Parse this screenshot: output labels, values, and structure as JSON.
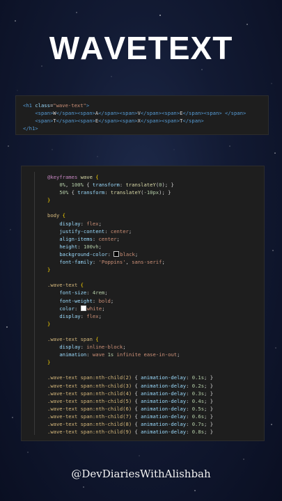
{
  "title": {
    "letters": [
      "W",
      "A",
      "V",
      "E",
      "T",
      "E",
      "X",
      "T"
    ]
  },
  "html_code": [
    [
      [
        "tag",
        "<h1 "
      ],
      [
        "attr",
        "class"
      ],
      [
        "txt",
        "="
      ],
      [
        "str",
        "\"wave-text\""
      ],
      [
        "tag",
        ">"
      ]
    ],
    [
      [
        "txt",
        "    "
      ],
      [
        "tag",
        "<span>"
      ],
      [
        "txt",
        "W"
      ],
      [
        "tag",
        "</span><span>"
      ],
      [
        "txt",
        "A"
      ],
      [
        "tag",
        "</span><span>"
      ],
      [
        "txt",
        "V"
      ],
      [
        "tag",
        "</span><span>"
      ],
      [
        "txt",
        "E"
      ],
      [
        "tag",
        "</span><span>"
      ],
      [
        "txt",
        " "
      ],
      [
        "tag",
        "</span>"
      ]
    ],
    [
      [
        "txt",
        "    "
      ],
      [
        "tag",
        "<span>"
      ],
      [
        "txt",
        "T"
      ],
      [
        "tag",
        "</span><span>"
      ],
      [
        "txt",
        "E"
      ],
      [
        "tag",
        "</span><span>"
      ],
      [
        "txt",
        "X"
      ],
      [
        "tag",
        "</span><span>"
      ],
      [
        "txt",
        "T"
      ],
      [
        "tag",
        "</span>"
      ]
    ],
    [
      [
        "tag",
        "</h1>"
      ]
    ]
  ],
  "css_code": [
    [
      [
        "kw",
        "@keyframes"
      ],
      [
        "txt",
        " "
      ],
      [
        "name",
        "wave"
      ],
      [
        "txt",
        " "
      ],
      [
        "brace",
        "{"
      ]
    ],
    [
      [
        "txt",
        "    "
      ],
      [
        "num",
        "0%"
      ],
      [
        "txt",
        ", "
      ],
      [
        "num",
        "100%"
      ],
      [
        "txt",
        " { "
      ],
      [
        "prop",
        "transform"
      ],
      [
        "txt",
        ": "
      ],
      [
        "fn",
        "translateY"
      ],
      [
        "txt",
        "("
      ],
      [
        "num",
        "0"
      ],
      [
        "txt",
        "); }"
      ]
    ],
    [
      [
        "txt",
        "    "
      ],
      [
        "num",
        "50%"
      ],
      [
        "txt",
        " { "
      ],
      [
        "prop",
        "transform"
      ],
      [
        "txt",
        ": "
      ],
      [
        "fn",
        "translateY"
      ],
      [
        "txt",
        "("
      ],
      [
        "num",
        "-10px"
      ],
      [
        "txt",
        "); }"
      ]
    ],
    [
      [
        "brace",
        "}"
      ]
    ],
    [],
    [
      [
        "sel",
        "body"
      ],
      [
        "txt",
        " "
      ],
      [
        "brace",
        "{"
      ]
    ],
    [
      [
        "txt",
        "    "
      ],
      [
        "prop",
        "display"
      ],
      [
        "txt",
        ": "
      ],
      [
        "val",
        "flex"
      ],
      [
        "txt",
        ";"
      ]
    ],
    [
      [
        "txt",
        "    "
      ],
      [
        "prop",
        "justify-content"
      ],
      [
        "txt",
        ": "
      ],
      [
        "val",
        "center"
      ],
      [
        "txt",
        ";"
      ]
    ],
    [
      [
        "txt",
        "    "
      ],
      [
        "prop",
        "align-items"
      ],
      [
        "txt",
        ": "
      ],
      [
        "val",
        "center"
      ],
      [
        "txt",
        ";"
      ]
    ],
    [
      [
        "txt",
        "    "
      ],
      [
        "prop",
        "height"
      ],
      [
        "txt",
        ": "
      ],
      [
        "num",
        "100vh"
      ],
      [
        "txt",
        ";"
      ]
    ],
    [
      [
        "txt",
        "    "
      ],
      [
        "prop",
        "background-color"
      ],
      [
        "txt",
        ": "
      ],
      [
        "swatch",
        "#000000"
      ],
      [
        "val",
        "black"
      ],
      [
        "txt",
        ";"
      ]
    ],
    [
      [
        "txt",
        "    "
      ],
      [
        "prop",
        "font-family"
      ],
      [
        "txt",
        ": "
      ],
      [
        "str",
        "'Poppins'"
      ],
      [
        "txt",
        ", "
      ],
      [
        "val",
        "sans-serif"
      ],
      [
        "txt",
        ";"
      ]
    ],
    [
      [
        "brace",
        "}"
      ]
    ],
    [],
    [
      [
        "sel",
        ".wave-text"
      ],
      [
        "txt",
        " "
      ],
      [
        "brace",
        "{"
      ]
    ],
    [
      [
        "txt",
        "    "
      ],
      [
        "prop",
        "font-size"
      ],
      [
        "txt",
        ": "
      ],
      [
        "num",
        "4rem"
      ],
      [
        "txt",
        ";"
      ]
    ],
    [
      [
        "txt",
        "    "
      ],
      [
        "prop",
        "font-weight"
      ],
      [
        "txt",
        ": "
      ],
      [
        "val",
        "bold"
      ],
      [
        "txt",
        ";"
      ]
    ],
    [
      [
        "txt",
        "    "
      ],
      [
        "prop",
        "color"
      ],
      [
        "txt",
        ": "
      ],
      [
        "swatch",
        "#ffffff"
      ],
      [
        "val",
        "white"
      ],
      [
        "txt",
        ";"
      ]
    ],
    [
      [
        "txt",
        "    "
      ],
      [
        "prop",
        "display"
      ],
      [
        "txt",
        ": "
      ],
      [
        "val",
        "flex"
      ],
      [
        "txt",
        ";"
      ]
    ],
    [
      [
        "brace",
        "}"
      ]
    ],
    [],
    [
      [
        "sel",
        ".wave-text span"
      ],
      [
        "txt",
        " "
      ],
      [
        "brace",
        "{"
      ]
    ],
    [
      [
        "txt",
        "    "
      ],
      [
        "prop",
        "display"
      ],
      [
        "txt",
        ": "
      ],
      [
        "val",
        "inline-block"
      ],
      [
        "txt",
        ";"
      ]
    ],
    [
      [
        "txt",
        "    "
      ],
      [
        "prop",
        "animation"
      ],
      [
        "txt",
        ": "
      ],
      [
        "val",
        "wave"
      ],
      [
        "txt",
        " "
      ],
      [
        "num",
        "1s"
      ],
      [
        "txt",
        " "
      ],
      [
        "val",
        "infinite"
      ],
      [
        "txt",
        " "
      ],
      [
        "val",
        "ease-in-out"
      ],
      [
        "txt",
        ";"
      ]
    ],
    [
      [
        "brace",
        "}"
      ]
    ],
    [],
    [
      [
        "sel",
        ".wave-text span:nth-child(2)"
      ],
      [
        "txt",
        " { "
      ],
      [
        "prop",
        "animation-delay"
      ],
      [
        "txt",
        ": "
      ],
      [
        "num",
        "0.1s"
      ],
      [
        "txt",
        "; }"
      ]
    ],
    [
      [
        "sel",
        ".wave-text span:nth-child(3)"
      ],
      [
        "txt",
        " { "
      ],
      [
        "prop",
        "animation-delay"
      ],
      [
        "txt",
        ": "
      ],
      [
        "num",
        "0.2s"
      ],
      [
        "txt",
        "; }"
      ]
    ],
    [
      [
        "sel",
        ".wave-text span:nth-child(4)"
      ],
      [
        "txt",
        " { "
      ],
      [
        "prop",
        "animation-delay"
      ],
      [
        "txt",
        ": "
      ],
      [
        "num",
        "0.3s"
      ],
      [
        "txt",
        "; }"
      ]
    ],
    [
      [
        "sel",
        ".wave-text span:nth-child(5)"
      ],
      [
        "txt",
        " { "
      ],
      [
        "prop",
        "animation-delay"
      ],
      [
        "txt",
        ": "
      ],
      [
        "num",
        "0.4s"
      ],
      [
        "txt",
        "; }"
      ]
    ],
    [
      [
        "sel",
        ".wave-text span:nth-child(6)"
      ],
      [
        "txt",
        " { "
      ],
      [
        "prop",
        "animation-delay"
      ],
      [
        "txt",
        ": "
      ],
      [
        "num",
        "0.5s"
      ],
      [
        "txt",
        "; }"
      ]
    ],
    [
      [
        "sel",
        ".wave-text span:nth-child(7)"
      ],
      [
        "txt",
        " { "
      ],
      [
        "prop",
        "animation-delay"
      ],
      [
        "txt",
        ": "
      ],
      [
        "num",
        "0.6s"
      ],
      [
        "txt",
        "; }"
      ]
    ],
    [
      [
        "sel",
        ".wave-text span:nth-child(8)"
      ],
      [
        "txt",
        " { "
      ],
      [
        "prop",
        "animation-delay"
      ],
      [
        "txt",
        ": "
      ],
      [
        "num",
        "0.7s"
      ],
      [
        "txt",
        "; }"
      ]
    ],
    [
      [
        "sel",
        ".wave-text span:nth-child(9)"
      ],
      [
        "txt",
        " { "
      ],
      [
        "prop",
        "animation-delay"
      ],
      [
        "txt",
        ": "
      ],
      [
        "num",
        "0.8s"
      ],
      [
        "txt",
        "; }"
      ]
    ]
  ],
  "handle": "@DevDiariesWithAlishbah"
}
